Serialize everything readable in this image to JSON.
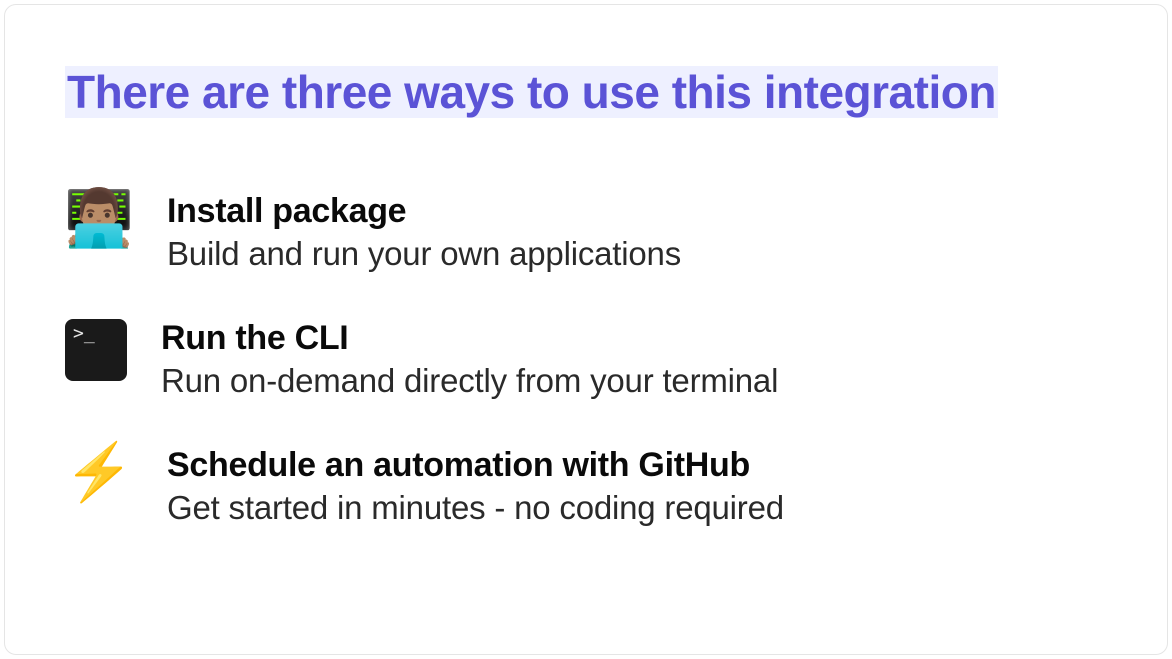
{
  "heading": "There are three ways to use this integration",
  "items": [
    {
      "icon": "technologist-emoji",
      "glyph": "👨🏽‍💻",
      "title": "Install package",
      "desc": "Build and run your own applications"
    },
    {
      "icon": "terminal-icon",
      "glyph": ">_",
      "title": "Run the CLI",
      "desc": "Run on-demand directly from your terminal"
    },
    {
      "icon": "lightning-icon",
      "glyph": "⚡",
      "title": "Schedule an automation with GitHub",
      "desc": "Get started in minutes - no coding required"
    }
  ]
}
